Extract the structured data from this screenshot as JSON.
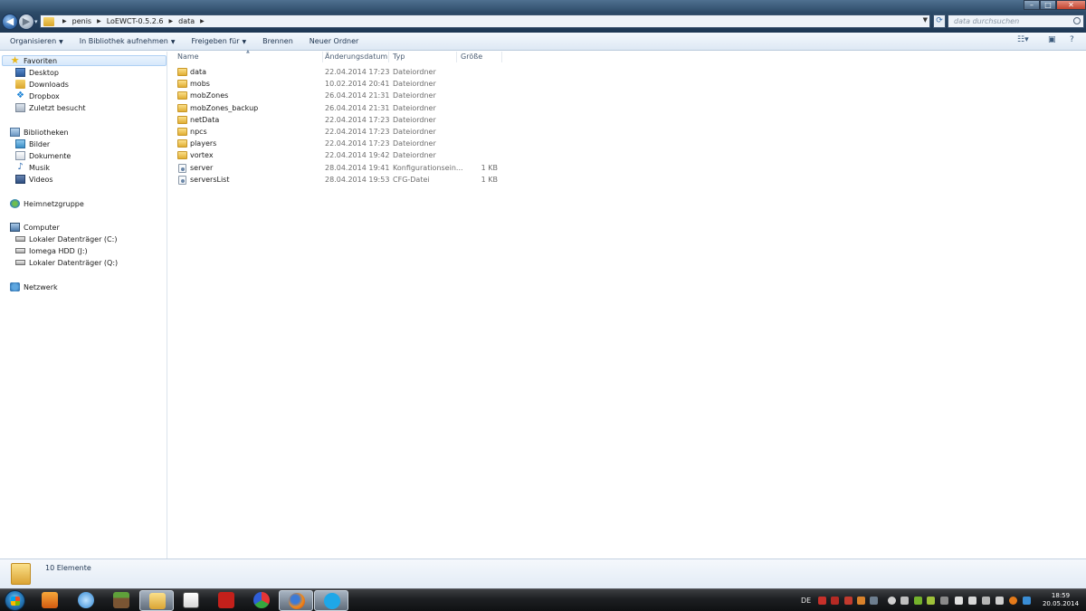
{
  "window": {
    "breadcrumb": [
      "penis",
      "LoEWCT-0.5.2.6",
      "data"
    ],
    "search_placeholder": "data durchsuchen"
  },
  "toolbar": {
    "organize": "Organisieren",
    "include_library": "In Bibliothek aufnehmen",
    "share": "Freigeben für",
    "burn": "Brennen",
    "new_folder": "Neuer Ordner"
  },
  "nav": {
    "favorites": "Favoriten",
    "desktop": "Desktop",
    "downloads": "Downloads",
    "dropbox": "Dropbox",
    "recent": "Zuletzt besucht",
    "libraries": "Bibliotheken",
    "pictures": "Bilder",
    "documents": "Dokumente",
    "music": "Musik",
    "videos": "Videos",
    "homegroup": "Heimnetzgruppe",
    "computer": "Computer",
    "drive_c": "Lokaler Datenträger (C:)",
    "drive_j": "Iomega HDD (J:)",
    "drive_q": "Lokaler Datenträger (Q:)",
    "network": "Netzwerk"
  },
  "columns": {
    "name": "Name",
    "date": "Änderungsdatum",
    "type": "Typ",
    "size": "Größe"
  },
  "files": [
    {
      "name": "data",
      "date": "22.04.2014 17:23",
      "type": "Dateiordner",
      "size": "",
      "kind": "folder"
    },
    {
      "name": "mobs",
      "date": "10.02.2014 20:41",
      "type": "Dateiordner",
      "size": "",
      "kind": "folder"
    },
    {
      "name": "mobZones",
      "date": "26.04.2014 21:31",
      "type": "Dateiordner",
      "size": "",
      "kind": "folder"
    },
    {
      "name": "mobZones_backup",
      "date": "26.04.2014 21:31",
      "type": "Dateiordner",
      "size": "",
      "kind": "folder"
    },
    {
      "name": "netData",
      "date": "22.04.2014 17:23",
      "type": "Dateiordner",
      "size": "",
      "kind": "folder"
    },
    {
      "name": "npcs",
      "date": "22.04.2014 17:23",
      "type": "Dateiordner",
      "size": "",
      "kind": "folder"
    },
    {
      "name": "players",
      "date": "22.04.2014 17:23",
      "type": "Dateiordner",
      "size": "",
      "kind": "folder"
    },
    {
      "name": "vortex",
      "date": "22.04.2014 19:42",
      "type": "Dateiordner",
      "size": "",
      "kind": "folder"
    },
    {
      "name": "server",
      "date": "28.04.2014 19:41",
      "type": "Konfigurationsein...",
      "size": "1 KB",
      "kind": "file"
    },
    {
      "name": "serversList",
      "date": "28.04.2014 19:53",
      "type": "CFG-Datei",
      "size": "1 KB",
      "kind": "file"
    }
  ],
  "status": {
    "count": "10 Elemente"
  },
  "taskbar": {
    "language": "DE",
    "time": "18:59",
    "date": "20.05.2014"
  }
}
